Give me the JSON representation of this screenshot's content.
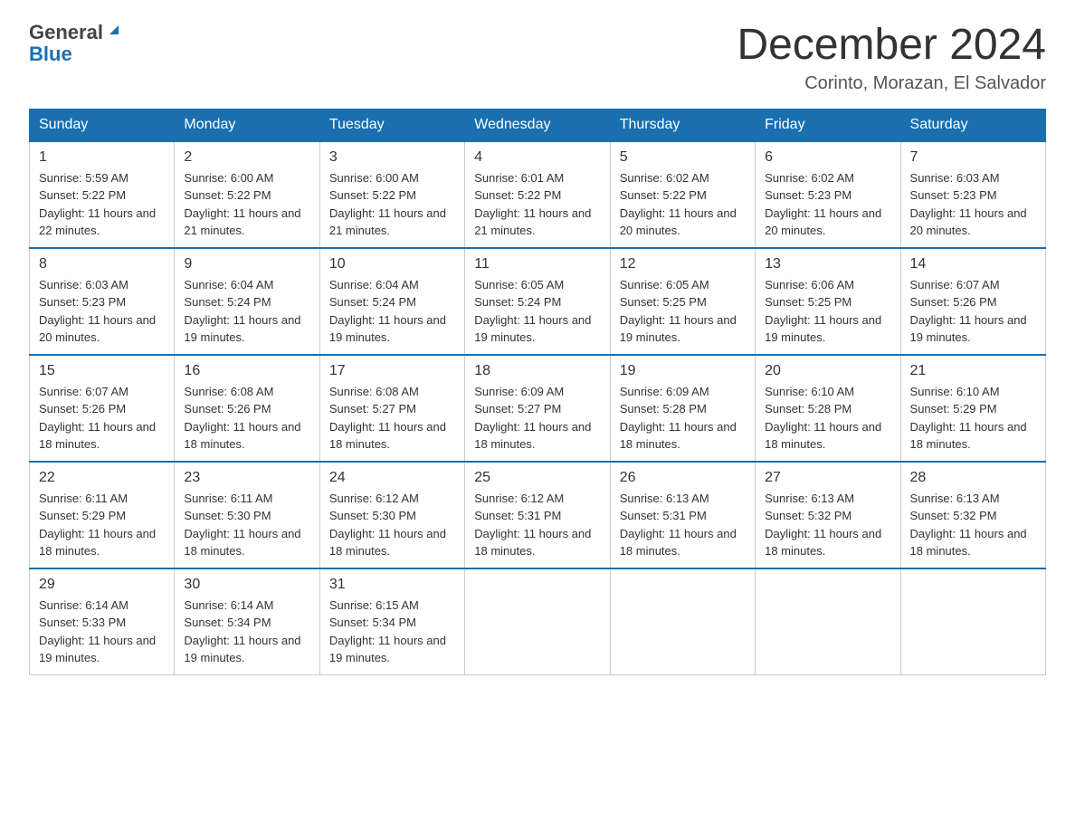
{
  "logo": {
    "line1": "General",
    "line2": "Blue"
  },
  "title": "December 2024",
  "subtitle": "Corinto, Morazan, El Salvador",
  "days": [
    "Sunday",
    "Monday",
    "Tuesday",
    "Wednesday",
    "Thursday",
    "Friday",
    "Saturday"
  ],
  "weeks": [
    [
      {
        "num": "1",
        "sunrise": "5:59 AM",
        "sunset": "5:22 PM",
        "daylight": "11 hours and 22 minutes."
      },
      {
        "num": "2",
        "sunrise": "6:00 AM",
        "sunset": "5:22 PM",
        "daylight": "11 hours and 21 minutes."
      },
      {
        "num": "3",
        "sunrise": "6:00 AM",
        "sunset": "5:22 PM",
        "daylight": "11 hours and 21 minutes."
      },
      {
        "num": "4",
        "sunrise": "6:01 AM",
        "sunset": "5:22 PM",
        "daylight": "11 hours and 21 minutes."
      },
      {
        "num": "5",
        "sunrise": "6:02 AM",
        "sunset": "5:22 PM",
        "daylight": "11 hours and 20 minutes."
      },
      {
        "num": "6",
        "sunrise": "6:02 AM",
        "sunset": "5:23 PM",
        "daylight": "11 hours and 20 minutes."
      },
      {
        "num": "7",
        "sunrise": "6:03 AM",
        "sunset": "5:23 PM",
        "daylight": "11 hours and 20 minutes."
      }
    ],
    [
      {
        "num": "8",
        "sunrise": "6:03 AM",
        "sunset": "5:23 PM",
        "daylight": "11 hours and 20 minutes."
      },
      {
        "num": "9",
        "sunrise": "6:04 AM",
        "sunset": "5:24 PM",
        "daylight": "11 hours and 19 minutes."
      },
      {
        "num": "10",
        "sunrise": "6:04 AM",
        "sunset": "5:24 PM",
        "daylight": "11 hours and 19 minutes."
      },
      {
        "num": "11",
        "sunrise": "6:05 AM",
        "sunset": "5:24 PM",
        "daylight": "11 hours and 19 minutes."
      },
      {
        "num": "12",
        "sunrise": "6:05 AM",
        "sunset": "5:25 PM",
        "daylight": "11 hours and 19 minutes."
      },
      {
        "num": "13",
        "sunrise": "6:06 AM",
        "sunset": "5:25 PM",
        "daylight": "11 hours and 19 minutes."
      },
      {
        "num": "14",
        "sunrise": "6:07 AM",
        "sunset": "5:26 PM",
        "daylight": "11 hours and 19 minutes."
      }
    ],
    [
      {
        "num": "15",
        "sunrise": "6:07 AM",
        "sunset": "5:26 PM",
        "daylight": "11 hours and 18 minutes."
      },
      {
        "num": "16",
        "sunrise": "6:08 AM",
        "sunset": "5:26 PM",
        "daylight": "11 hours and 18 minutes."
      },
      {
        "num": "17",
        "sunrise": "6:08 AM",
        "sunset": "5:27 PM",
        "daylight": "11 hours and 18 minutes."
      },
      {
        "num": "18",
        "sunrise": "6:09 AM",
        "sunset": "5:27 PM",
        "daylight": "11 hours and 18 minutes."
      },
      {
        "num": "19",
        "sunrise": "6:09 AM",
        "sunset": "5:28 PM",
        "daylight": "11 hours and 18 minutes."
      },
      {
        "num": "20",
        "sunrise": "6:10 AM",
        "sunset": "5:28 PM",
        "daylight": "11 hours and 18 minutes."
      },
      {
        "num": "21",
        "sunrise": "6:10 AM",
        "sunset": "5:29 PM",
        "daylight": "11 hours and 18 minutes."
      }
    ],
    [
      {
        "num": "22",
        "sunrise": "6:11 AM",
        "sunset": "5:29 PM",
        "daylight": "11 hours and 18 minutes."
      },
      {
        "num": "23",
        "sunrise": "6:11 AM",
        "sunset": "5:30 PM",
        "daylight": "11 hours and 18 minutes."
      },
      {
        "num": "24",
        "sunrise": "6:12 AM",
        "sunset": "5:30 PM",
        "daylight": "11 hours and 18 minutes."
      },
      {
        "num": "25",
        "sunrise": "6:12 AM",
        "sunset": "5:31 PM",
        "daylight": "11 hours and 18 minutes."
      },
      {
        "num": "26",
        "sunrise": "6:13 AM",
        "sunset": "5:31 PM",
        "daylight": "11 hours and 18 minutes."
      },
      {
        "num": "27",
        "sunrise": "6:13 AM",
        "sunset": "5:32 PM",
        "daylight": "11 hours and 18 minutes."
      },
      {
        "num": "28",
        "sunrise": "6:13 AM",
        "sunset": "5:32 PM",
        "daylight": "11 hours and 18 minutes."
      }
    ],
    [
      {
        "num": "29",
        "sunrise": "6:14 AM",
        "sunset": "5:33 PM",
        "daylight": "11 hours and 19 minutes."
      },
      {
        "num": "30",
        "sunrise": "6:14 AM",
        "sunset": "5:34 PM",
        "daylight": "11 hours and 19 minutes."
      },
      {
        "num": "31",
        "sunrise": "6:15 AM",
        "sunset": "5:34 PM",
        "daylight": "11 hours and 19 minutes."
      },
      null,
      null,
      null,
      null
    ]
  ],
  "labels": {
    "sunrise": "Sunrise:",
    "sunset": "Sunset:",
    "daylight": "Daylight:"
  }
}
